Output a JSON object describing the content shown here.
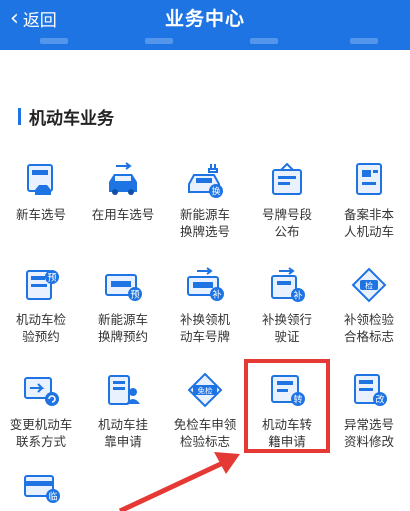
{
  "header": {
    "back_label": "返回",
    "title": "业务中心"
  },
  "section": {
    "title": "机动车业务"
  },
  "items": [
    {
      "label": "新车选号",
      "icon": "new-car-plate-icon"
    },
    {
      "label": "在用车选号",
      "icon": "used-car-plate-icon"
    },
    {
      "label": "新能源车换牌选号",
      "icon": "ev-plate-swap-icon"
    },
    {
      "label": "号牌号段公布",
      "icon": "plate-range-notice-icon"
    },
    {
      "label": "备案非本人机动车",
      "icon": "vehicle-filing-icon"
    },
    {
      "label": "机动车检验预约",
      "icon": "inspection-booking-icon"
    },
    {
      "label": "新能源车换牌预约",
      "icon": "ev-plate-booking-icon"
    },
    {
      "label": "补换领机动车号牌",
      "icon": "plate-replace-icon"
    },
    {
      "label": "补换领行驶证",
      "icon": "license-replace-icon"
    },
    {
      "label": "补领检验合格标志",
      "icon": "inspection-sticker-icon"
    },
    {
      "label": "变更机动车联系方式",
      "icon": "contact-change-icon"
    },
    {
      "label": "机动车挂靠申请",
      "icon": "affiliation-icon"
    },
    {
      "label": "免检车申领检验标志",
      "icon": "exempt-sticker-icon"
    },
    {
      "label": "机动车转籍申请",
      "icon": "transfer-registration-icon"
    },
    {
      "label": "异常选号资料修改",
      "icon": "plate-data-edit-icon"
    },
    {
      "label": "",
      "icon": "temporary-plate-icon"
    }
  ],
  "colors": {
    "primary": "#1f74e3",
    "highlight": "#e53935",
    "icon_light": "#e8f1fd"
  },
  "badges": {
    "swap": "换",
    "book": "预",
    "patch": "补",
    "check": "检",
    "exempt": "免检",
    "transfer": "转",
    "edit": "改",
    "lead": "临"
  }
}
